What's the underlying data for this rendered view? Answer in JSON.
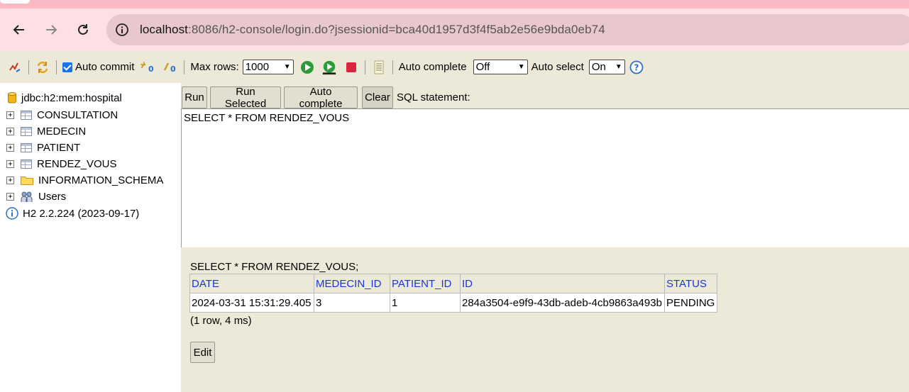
{
  "browser": {
    "url_host": "localhost",
    "url_rest": ":8086/h2-console/login.do?jsessionid=bca40d1957d3f4f5ab2e56e9bda0eb74"
  },
  "toolbar": {
    "auto_commit_label": "Auto commit",
    "auto_commit_checked": true,
    "max_rows_label": "Max rows:",
    "max_rows_value": "1000",
    "auto_complete_label": "Auto complete",
    "auto_complete_value": "Off",
    "auto_select_label": "Auto select",
    "auto_select_value": "On",
    "colors": {
      "run_green": "#2e9a3a",
      "stop_red": "#d7263d",
      "help_blue": "#2a6fc9"
    }
  },
  "tree": {
    "connection": "jdbc:h2:mem:hospital",
    "items": [
      {
        "label": "CONSULTATION",
        "icon": "table-icon"
      },
      {
        "label": "MEDECIN",
        "icon": "table-icon"
      },
      {
        "label": "PATIENT",
        "icon": "table-icon"
      },
      {
        "label": "RENDEZ_VOUS",
        "icon": "table-icon"
      },
      {
        "label": "INFORMATION_SCHEMA",
        "icon": "folder-icon"
      },
      {
        "label": "Users",
        "icon": "users-icon"
      }
    ],
    "version": "H2 2.2.224 (2023-09-17)"
  },
  "query": {
    "buttons": {
      "run": "Run",
      "run_selected": "Run Selected",
      "auto_complete": "Auto complete",
      "clear": "Clear"
    },
    "sql_label": "SQL statement:",
    "sql_text": "SELECT * FROM RENDEZ_VOUS"
  },
  "results": {
    "statement": "SELECT * FROM RENDEZ_VOUS;",
    "columns": [
      "DATE",
      "MEDECIN_ID",
      "PATIENT_ID",
      "ID",
      "STATUS"
    ],
    "rows": [
      [
        "2024-03-31 15:31:29.405",
        "3",
        "1",
        "284a3504-e9f9-43db-adeb-4cb9863a493b",
        "PENDING"
      ]
    ],
    "summary": "(1 row, 4 ms)",
    "edit_label": "Edit"
  }
}
